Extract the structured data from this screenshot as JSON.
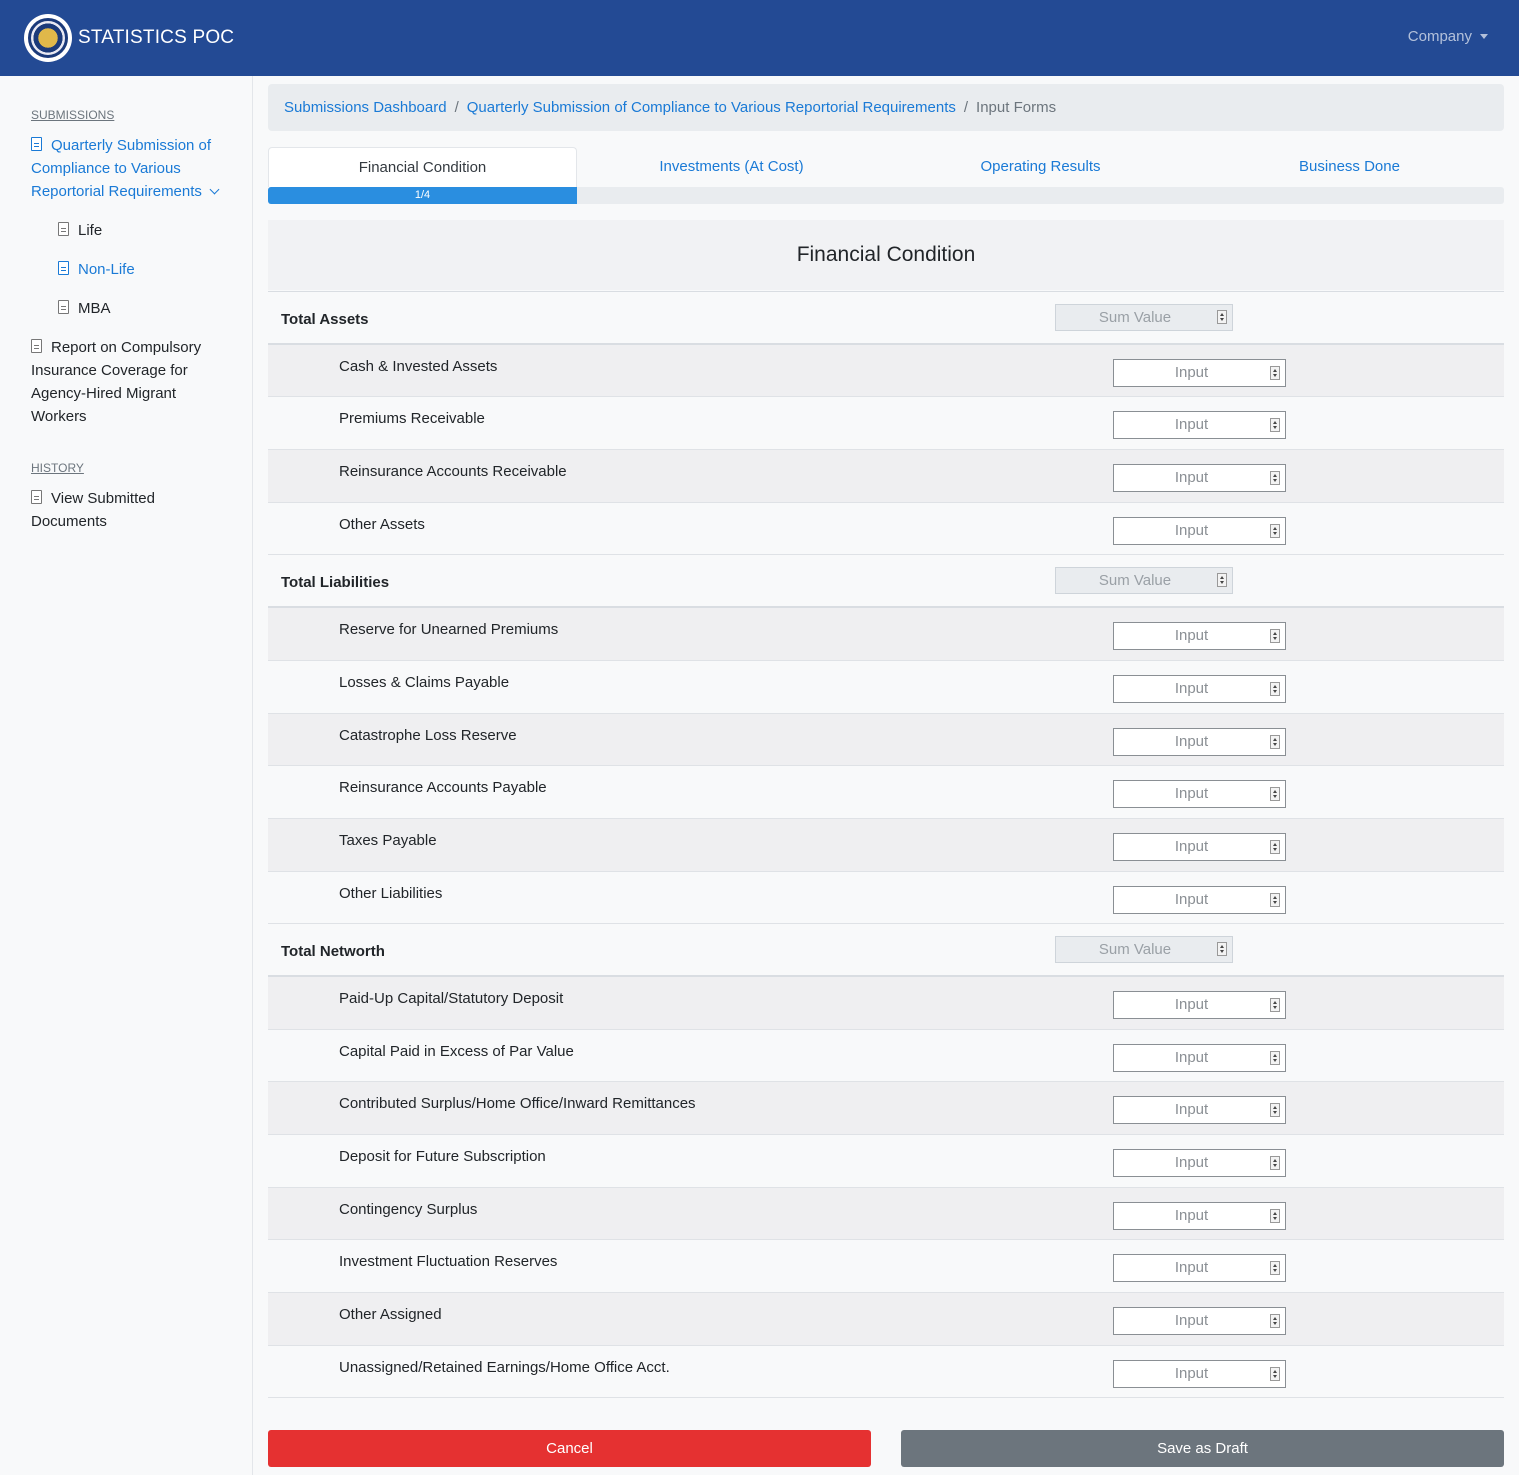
{
  "header": {
    "title": "STATISTICS POC",
    "company_label": "Company"
  },
  "sidebar": {
    "submissions_heading": "SUBMISSIONS",
    "history_heading": "HISTORY",
    "quarterly": "Quarterly Submission of Compliance to Various Reportorial Requirements",
    "sub_items": [
      "Life",
      "Non-Life",
      "MBA"
    ],
    "report": "Report on Compulsory Insurance Coverage for Agency-Hired Migrant Workers",
    "view_submitted": "View Submitted Documents"
  },
  "breadcrumb": {
    "items": [
      "Submissions Dashboard",
      "Quarterly Submission of Compliance to Various Reportorial Requirements"
    ],
    "current": "Input Forms"
  },
  "tabs": [
    "Financial Condition",
    "Investments (At Cost)",
    "Operating Results",
    "Business Done"
  ],
  "progress": {
    "label": "1/4",
    "fraction": 0.25
  },
  "form": {
    "title": "Financial Condition",
    "sum_placeholder": "Sum Value",
    "input_placeholder": "Input",
    "sections": [
      {
        "title": "Total Assets",
        "items": [
          "Cash & Invested Assets",
          "Premiums Receivable",
          "Reinsurance Accounts Receivable",
          "Other Assets"
        ]
      },
      {
        "title": "Total Liabilities",
        "items": [
          "Reserve for Unearned Premiums",
          "Losses & Claims Payable",
          "Catastrophe Loss Reserve",
          "Reinsurance Accounts Payable",
          "Taxes Payable",
          "Other Liabilities"
        ]
      },
      {
        "title": "Total Networth",
        "items": [
          "Paid-Up Capital/Statutory Deposit",
          "Capital Paid in Excess of Par Value",
          "Contributed Surplus/Home Office/Inward Remittances",
          "Deposit for Future Subscription",
          "Contingency Surplus",
          "Investment Fluctuation Reserves",
          "Other Assigned",
          "Unassigned/Retained Earnings/Home Office Acct."
        ]
      }
    ]
  },
  "buttons": {
    "cancel": "Cancel",
    "save_draft": "Save as Draft"
  }
}
